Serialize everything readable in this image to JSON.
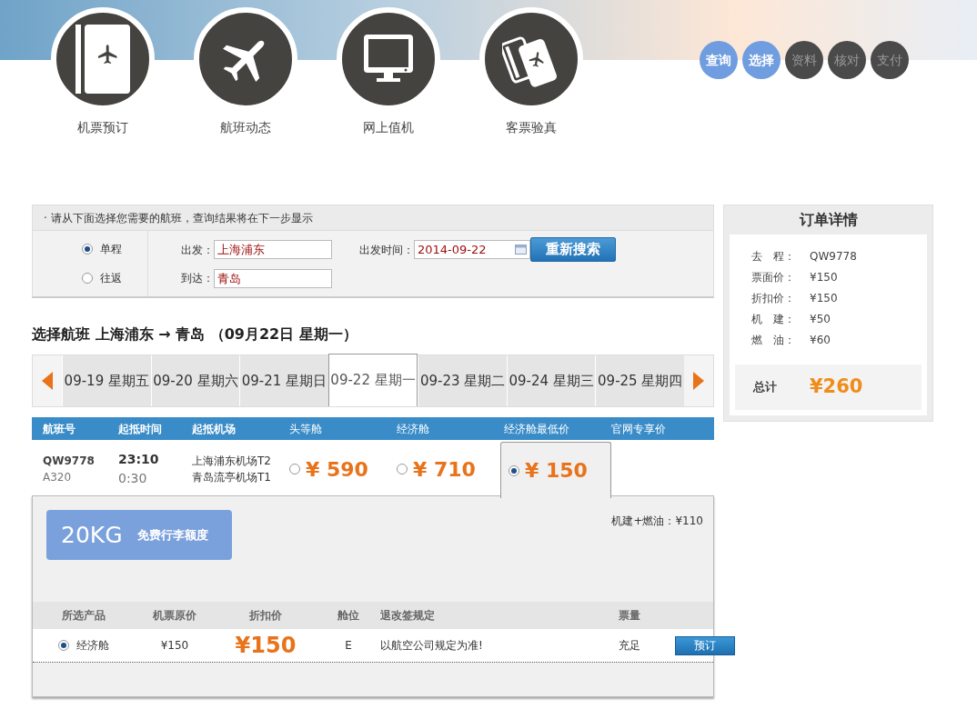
{
  "nav_items": [
    {
      "label": "机票预订"
    },
    {
      "label": "航班动态"
    },
    {
      "label": "网上值机"
    },
    {
      "label": "客票验真"
    }
  ],
  "steps": [
    {
      "label": "查询",
      "active": true
    },
    {
      "label": "选择",
      "active": true
    },
    {
      "label": "资料",
      "active": false
    },
    {
      "label": "核对",
      "active": false
    },
    {
      "label": "支付",
      "active": false
    }
  ],
  "search": {
    "note": "· 请从下面选择您需要的航班，查询结果将在下一步显示",
    "trip_types": [
      {
        "label": "单程",
        "selected": true
      },
      {
        "label": "往返",
        "selected": false
      }
    ],
    "from_label": "出发：",
    "from": "上海浦东",
    "to_label": "到达：",
    "to": "青岛",
    "date_label": "出发时间：",
    "date": "2014-09-22",
    "button": "重新搜索"
  },
  "route_title": "选择航班 上海浦东 → 青岛 （09月22日 星期一）",
  "dates": [
    {
      "label": "09-19 星期五",
      "selected": false
    },
    {
      "label": "09-20 星期六",
      "selected": false
    },
    {
      "label": "09-21 星期日",
      "selected": false
    },
    {
      "label": "09-22 星期一",
      "selected": true
    },
    {
      "label": "09-23 星期二",
      "selected": false
    },
    {
      "label": "09-24 星期三",
      "selected": false
    },
    {
      "label": "09-25 星期四",
      "selected": false
    }
  ],
  "flights": {
    "columns": [
      "航班号",
      "起抵时间",
      "起抵机场",
      "头等舱",
      "经济舱",
      "经济舱最低价",
      "官网专享价"
    ],
    "rows": [
      {
        "number": "QW9778",
        "aircraft": "A320",
        "depart": "23:10",
        "arrive": "0:30",
        "from_airport": "上海浦东机场T2",
        "to_airport": "青岛流亭机场T1",
        "fares": [
          {
            "price": "¥ 590",
            "selected": false
          },
          {
            "price": "¥ 710",
            "selected": false
          },
          {
            "price": "¥ 150",
            "selected": true
          }
        ]
      }
    ]
  },
  "detail": {
    "baggage_weight": "20KG",
    "baggage_label": "免费行李额度",
    "taxes": "机建+燃油：¥110",
    "columns": [
      "所选产品",
      "机票原价",
      "折扣价",
      "舱位",
      "退改签规定",
      "票量"
    ],
    "rows": [
      {
        "product": "经济舱",
        "selected": true,
        "original": "¥150",
        "discount": "¥150",
        "cabin": "E",
        "rules": "以航空公司规定为准!",
        "availability": "充足",
        "button": "预订"
      }
    ]
  },
  "order": {
    "title": "订单详情",
    "items": [
      {
        "label": "去　程：",
        "value": "QW9778"
      },
      {
        "label": "票面价：",
        "value": "¥150"
      },
      {
        "label": "折扣价：",
        "value": "¥150"
      },
      {
        "label": "机　建：",
        "value": "¥50"
      },
      {
        "label": "燃　油：",
        "value": "¥60"
      }
    ],
    "total_label": "总计",
    "total": "¥260"
  }
}
